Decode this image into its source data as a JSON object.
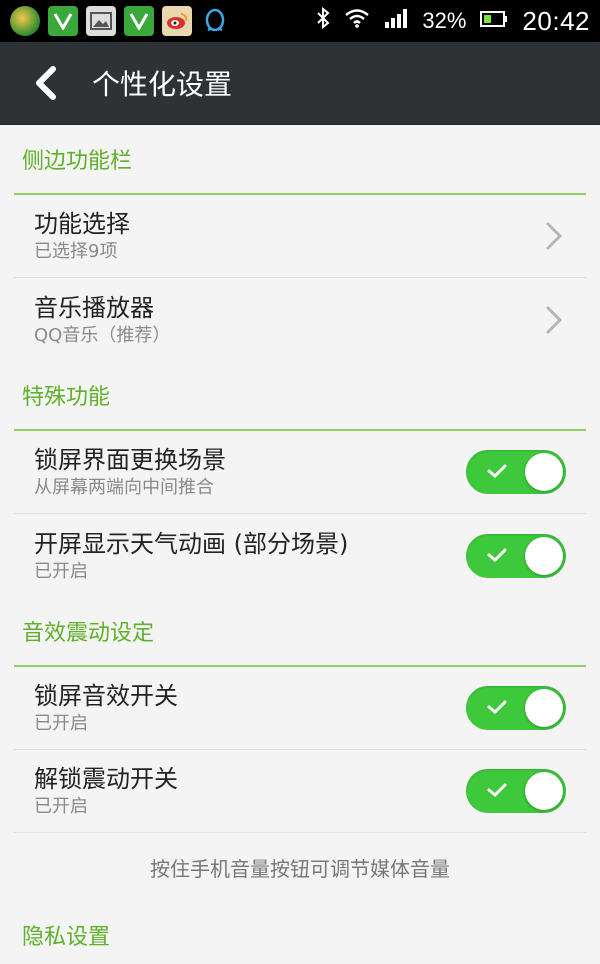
{
  "status_bar": {
    "battery_percent": "32%",
    "time": "20:42",
    "left_icons": [
      "app-logo-icon",
      "app-v-icon",
      "gallery-icon",
      "app-v-icon",
      "weibo-icon",
      "qq-icon"
    ],
    "right_icons": [
      "bluetooth-icon",
      "wifi-icon",
      "signal-icon",
      "battery-icon"
    ]
  },
  "header": {
    "title": "个性化设置"
  },
  "sections": [
    {
      "title": "侧边功能栏",
      "items": [
        {
          "title": "功能选择",
          "subtitle": "已选择9项",
          "control": "chevron"
        },
        {
          "title": "音乐播放器",
          "subtitle": "QQ音乐（推荐）",
          "control": "chevron"
        }
      ]
    },
    {
      "title": "特殊功能",
      "items": [
        {
          "title": "锁屏界面更换场景",
          "subtitle": "从屏幕两端向中间推合",
          "control": "toggle",
          "on": true
        },
        {
          "title": "开屏显示天气动画 (部分场景)",
          "subtitle": "已开启",
          "control": "toggle",
          "on": true
        }
      ]
    },
    {
      "title": "音效震动设定",
      "items": [
        {
          "title": "锁屏音效开关",
          "subtitle": "已开启",
          "control": "toggle",
          "on": true
        },
        {
          "title": "解锁震动开关",
          "subtitle": "已开启",
          "control": "toggle",
          "on": true
        }
      ],
      "note": "按住手机音量按钮可调节媒体音量"
    },
    {
      "title": "隐私设置",
      "items": []
    }
  ],
  "colors": {
    "accent": "#5fb02a",
    "toggle_on": "#3ec93c",
    "action_bar": "#2f3235"
  }
}
